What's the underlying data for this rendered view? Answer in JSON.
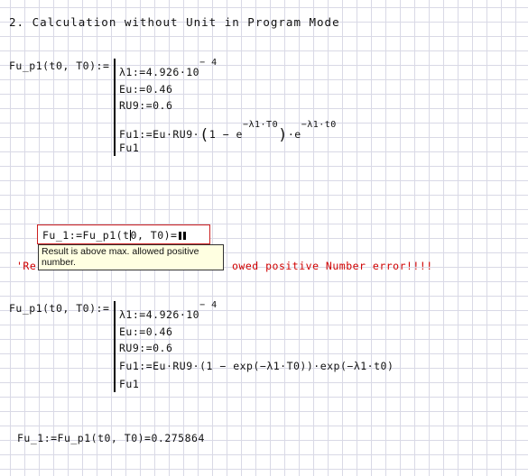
{
  "section_title": "2. Calculation without Unit in Program Mode",
  "block1": {
    "def": "Fu_p1(t0, T0)",
    "line1_lhs": "λ1",
    "line1_val": "4.926·10",
    "line1_exp": "− 4",
    "line2": "Eu:=0.46",
    "line3": "RU9:=0.6",
    "line4_a": "Fu1:=Eu·RU9·",
    "line4_b": "1 − e",
    "line4_exp": "−λ1·T0",
    "line4_c": "·e",
    "line4_exp2": "−λ1·t0",
    "line5": "Fu1"
  },
  "eval_error": {
    "expr_a": "Fu_1:=Fu_p1(t",
    "expr_b": "0, T0)=",
    "tooltip": "Result is above max. allowed positive number.",
    "error_left": "'Re",
    "error_right": "owed positive Number error!!!!"
  },
  "block2": {
    "def": "Fu_p1(t0, T0)",
    "line1_lhs": "λ1",
    "line1_val": "4.926·10",
    "line1_exp": "− 4",
    "line2": "Eu:=0.46",
    "line3": "RU9:=0.6",
    "line4": "Fu1:=Eu·RU9·(1 − exp(−λ1·T0))·exp(−λ1·t0)",
    "line5": "Fu1"
  },
  "result": {
    "expr": "Fu_1:=Fu_p1(t0, T0)=",
    "value": "0.275864"
  }
}
